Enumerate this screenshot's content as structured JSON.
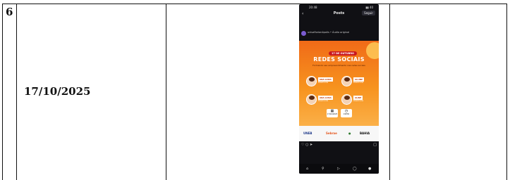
{
  "row": {
    "number": "6",
    "date": "17/10/2025"
  },
  "phone": {
    "status_time": "20:48",
    "status_right": "▮▮ 40",
    "header_title": "Posts",
    "back_icon": "chevron-left-icon",
    "follow_label": "Seguir",
    "user_line": "unisaflorianópolis • Áudio original",
    "poster": {
      "badge": "17 DE OUTUBRO",
      "title": "REDES SOCIAIS",
      "subtitle": "Formando seu empreendimento nas redes sociais",
      "speakers": [
        {
          "name": "ANA LUIZA",
          "role": "Palestrante"
        },
        {
          "name": "ALLINE",
          "role": "Palestrante"
        },
        {
          "name": "ANA LUISA",
          "role": "Palestrante"
        },
        {
          "name": "ALINE",
          "role": "Palestrante"
        }
      ],
      "info": [
        {
          "icon": "calendar-icon",
          "label": "17/10/2025"
        },
        {
          "icon": "clock-icon",
          "label": "19H30"
        }
      ]
    },
    "logos": [
      "UNEB",
      "Sebrae",
      "",
      "BAHIA"
    ],
    "actions": "♡ ○ ➤",
    "nav_icons": [
      "home-icon",
      "search-icon",
      "reels-icon",
      "shop-icon",
      "profile-icon"
    ]
  }
}
